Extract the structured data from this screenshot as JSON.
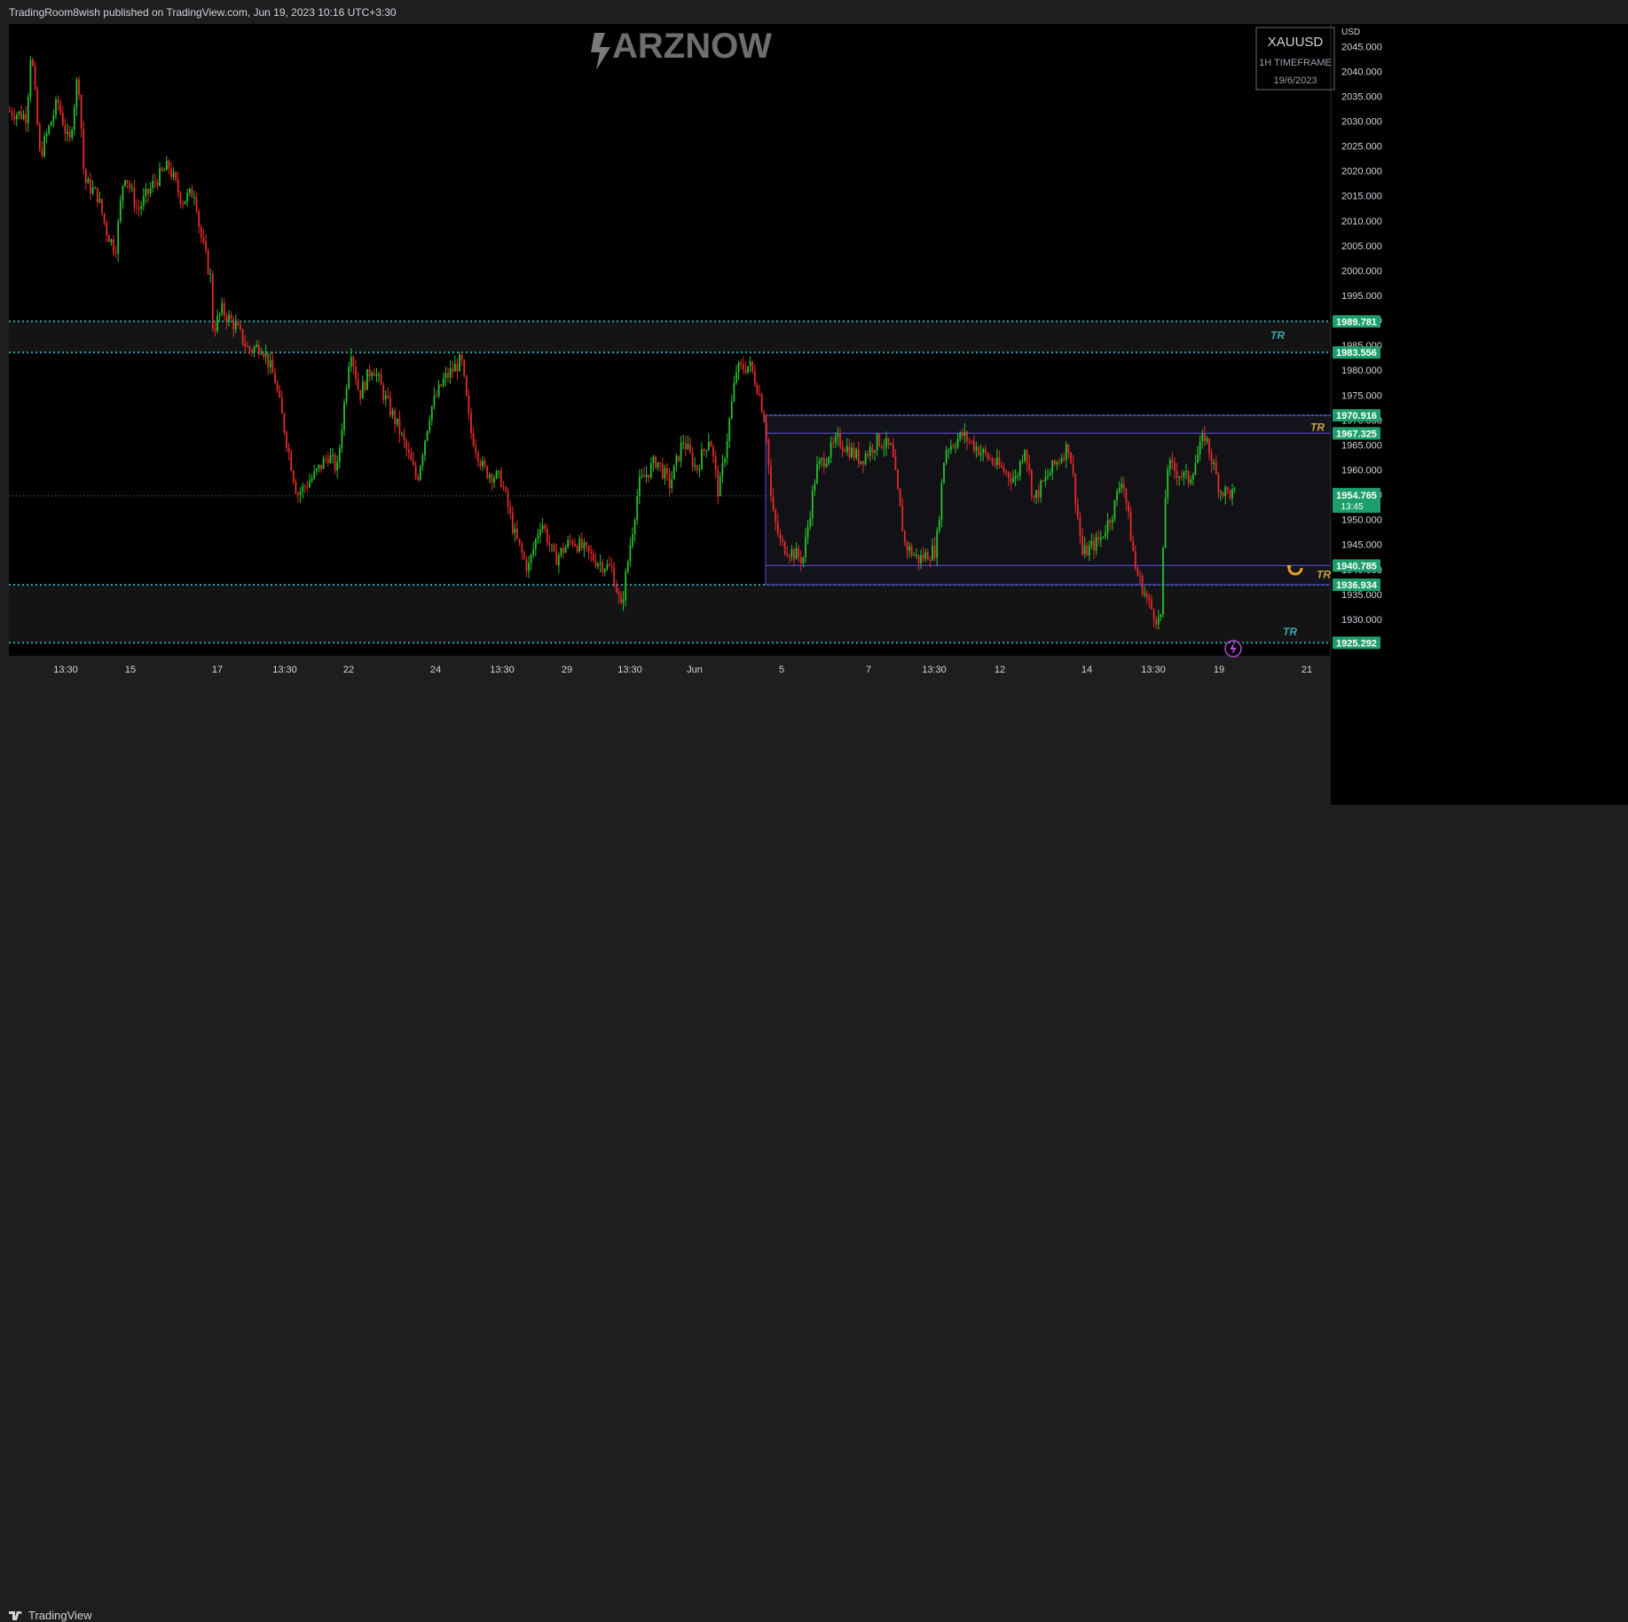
{
  "header": {
    "published_text": "TradingRoom8wish published on TradingView.com, Jun 19, 2023 10:16 UTC+3:30"
  },
  "watermark": {
    "text": "ARZNOW"
  },
  "infobox": {
    "symbol": "XAUUSD",
    "timeframe": "1H TIMEFRAME",
    "date": "19/6/2023"
  },
  "footer": {
    "brand": "TradingView"
  },
  "colors": {
    "up": "#26c22b",
    "down": "#e32b2b",
    "level": "#2fa3ad",
    "box": "#5b4cd6",
    "tr_teal": "#3aa6b0",
    "tr_gold": "#c8a23c",
    "label_bg": "#1e9e6c"
  },
  "chart_data": {
    "type": "candlestick",
    "symbol": "XAUUSD",
    "currency": "USD",
    "ylim": [
      1922.5,
      2049.5
    ],
    "y_ticks": [
      "2045.000",
      "2040.000",
      "2035.000",
      "2030.000",
      "2025.000",
      "2020.000",
      "2015.000",
      "2010.000",
      "2005.000",
      "2000.000",
      "1995.000",
      "1990.000",
      "1985.000",
      "1980.000",
      "1975.000",
      "1970.000",
      "1965.000",
      "1960.000",
      "1955.000",
      "1950.000",
      "1945.000",
      "1940.000",
      "1935.000",
      "1930.000"
    ],
    "x_ticks": [
      "13:30",
      "15",
      "17",
      "13:30",
      "22",
      "24",
      "13:30",
      "29",
      "13:30",
      "Jun",
      "5",
      "7",
      "13:30",
      "12",
      "14",
      "13:30",
      "19",
      "21"
    ],
    "levels": [
      {
        "price": 1989.781,
        "label": "1989.781"
      },
      {
        "price": 1983.556,
        "label": "1983.556"
      },
      {
        "price": 1970.916,
        "label": "1970.916"
      },
      {
        "price": 1967.325,
        "label": "1967.325"
      },
      {
        "price": 1940.785,
        "label": "1940.785"
      },
      {
        "price": 1936.934,
        "label": "1936.934"
      },
      {
        "price": 1925.292,
        "label": "1925.292"
      }
    ],
    "current_price": {
      "price": 1954.765,
      "label": "1954.765",
      "countdown": "13:45"
    },
    "annotations": [
      {
        "text": "TR",
        "price": 1987.0,
        "color": "teal"
      },
      {
        "text": "TR",
        "price": 1968.5,
        "color": "gold"
      },
      {
        "text": "TR",
        "price": 1939.0,
        "color": "gold"
      },
      {
        "text": "TR",
        "price": 1927.5,
        "color": "teal"
      }
    ],
    "range_boxes": [
      {
        "from_x_tick": "5",
        "top": 1970.916,
        "bottom": 1967.325
      },
      {
        "from_x_tick": "5",
        "top": 1967.325,
        "bottom": 1940.785
      },
      {
        "from_x_tick": "5",
        "top": 1940.785,
        "bottom": 1936.934
      }
    ],
    "price_path": [
      [
        0,
        2032
      ],
      [
        20,
        2031
      ],
      [
        25,
        2045
      ],
      [
        35,
        2023
      ],
      [
        55,
        2034
      ],
      [
        68,
        2025
      ],
      [
        78,
        2040
      ],
      [
        85,
        2018
      ],
      [
        100,
        2015
      ],
      [
        110,
        2008
      ],
      [
        120,
        2004
      ],
      [
        130,
        2020
      ],
      [
        145,
        2012
      ],
      [
        165,
        2018
      ],
      [
        180,
        2021
      ],
      [
        195,
        2014
      ],
      [
        210,
        2016
      ],
      [
        215,
        2008
      ],
      [
        228,
        1998
      ],
      [
        230,
        1988
      ],
      [
        240,
        1992
      ],
      [
        255,
        1989
      ],
      [
        270,
        1984
      ],
      [
        285,
        1985
      ],
      [
        300,
        1978
      ],
      [
        315,
        1964
      ],
      [
        325,
        1955
      ],
      [
        345,
        1959
      ],
      [
        360,
        1963
      ],
      [
        370,
        1960
      ],
      [
        385,
        1985
      ],
      [
        395,
        1975
      ],
      [
        410,
        1981
      ],
      [
        425,
        1974
      ],
      [
        440,
        1968
      ],
      [
        460,
        1958
      ],
      [
        475,
        1972
      ],
      [
        490,
        1978
      ],
      [
        510,
        1982
      ],
      [
        520,
        1968
      ],
      [
        535,
        1960
      ],
      [
        555,
        1958
      ],
      [
        570,
        1947
      ],
      [
        585,
        1940
      ],
      [
        600,
        1950
      ],
      [
        615,
        1942
      ],
      [
        635,
        1946
      ],
      [
        660,
        1942
      ],
      [
        680,
        1940
      ],
      [
        690,
        1932
      ],
      [
        710,
        1957
      ],
      [
        730,
        1962
      ],
      [
        745,
        1957
      ],
      [
        760,
        1966
      ],
      [
        775,
        1960
      ],
      [
        790,
        1967
      ],
      [
        800,
        1955
      ],
      [
        810,
        1967
      ],
      [
        820,
        1980
      ],
      [
        835,
        1981
      ],
      [
        845,
        1976
      ],
      [
        853,
        1969
      ],
      [
        860,
        1952
      ],
      [
        870,
        1945
      ],
      [
        895,
        1942
      ],
      [
        910,
        1960
      ],
      [
        935,
        1966
      ],
      [
        960,
        1962
      ],
      [
        980,
        1966
      ],
      [
        995,
        1964
      ],
      [
        1010,
        1945
      ],
      [
        1025,
        1942
      ],
      [
        1045,
        1944
      ],
      [
        1055,
        1964
      ],
      [
        1075,
        1967
      ],
      [
        1100,
        1963
      ],
      [
        1120,
        1960
      ],
      [
        1135,
        1958
      ],
      [
        1145,
        1965
      ],
      [
        1155,
        1954
      ],
      [
        1175,
        1960
      ],
      [
        1195,
        1965
      ],
      [
        1210,
        1943
      ],
      [
        1230,
        1946
      ],
      [
        1245,
        1952
      ],
      [
        1255,
        1959
      ],
      [
        1270,
        1940
      ],
      [
        1285,
        1933
      ],
      [
        1298,
        1929
      ],
      [
        1305,
        1961
      ],
      [
        1330,
        1958
      ],
      [
        1348,
        1967
      ],
      [
        1365,
        1956
      ],
      [
        1382,
        1955
      ]
    ]
  }
}
